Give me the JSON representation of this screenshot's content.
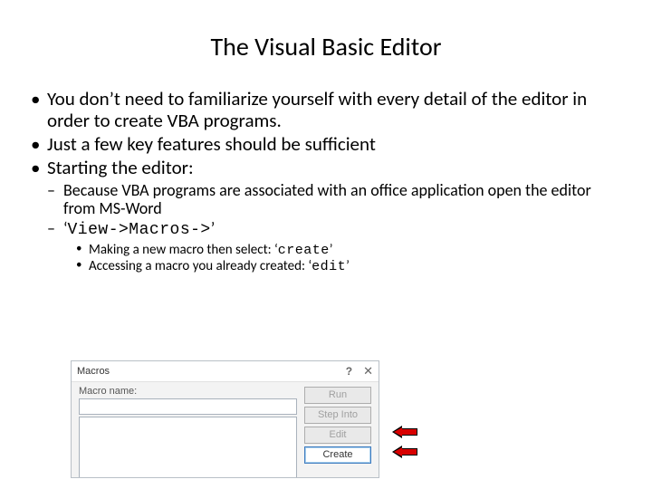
{
  "title": "The Visual Basic Editor",
  "bullets": {
    "b1": "You don’t need to familiarize yourself with every detail of the editor in order to create VBA programs.",
    "b2": "Just a few key features should be sufficient",
    "b3": "Starting the editor:",
    "b3_1": "Because VBA programs are associated with an office application open the editor from MS-Word",
    "b3_2_pre": "‘",
    "b3_2_code": "View->Macros->",
    "b3_2_post": "’",
    "b3_2_1_a": "Making a new macro then select: ‘",
    "b3_2_1_code": "create",
    "b3_2_1_b": "’",
    "b3_2_2_a": "Accessing a macro you already created: ‘",
    "b3_2_2_code": "edit",
    "b3_2_2_b": "’"
  },
  "dialog": {
    "title": "Macros",
    "name_label": "Macro name:",
    "buttons": {
      "run": "Run",
      "step": "Step Into",
      "edit": "Edit",
      "create": "Create"
    }
  }
}
